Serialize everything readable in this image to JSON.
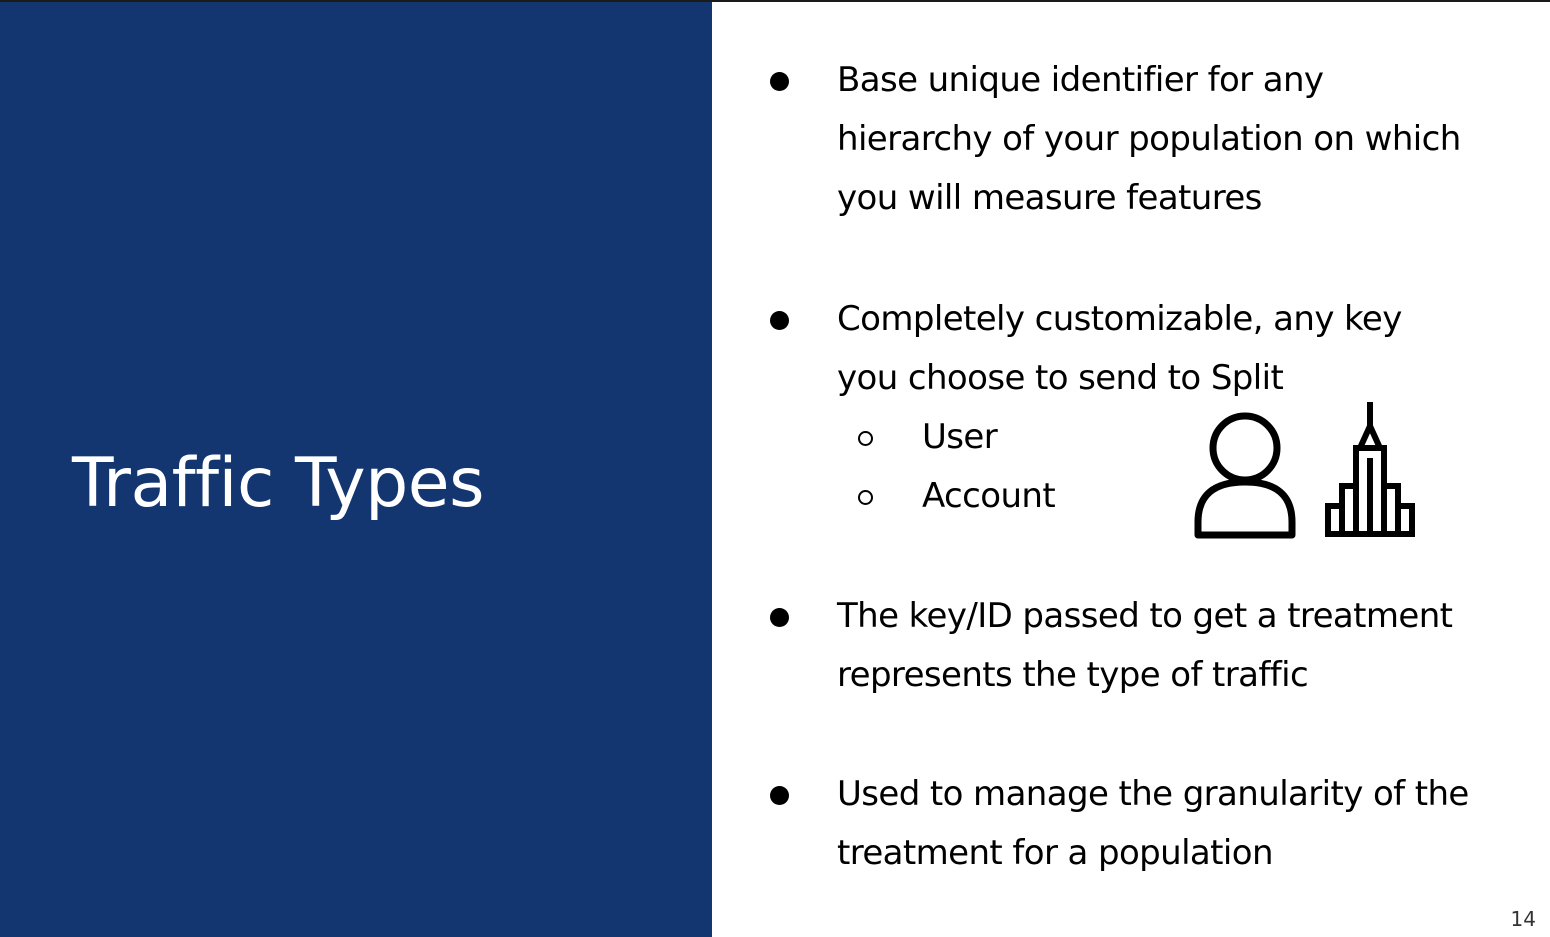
{
  "slide": {
    "title": "Traffic Types",
    "page_number": "14",
    "bullets": [
      {
        "lines": [
          "Base unique identifier for any",
          "hierarchy of your population on which",
          "you will measure features"
        ]
      },
      {
        "lines": [
          "Completely customizable,  any key",
          "you choose to send to Split"
        ],
        "sub_items": [
          "User",
          "Account"
        ]
      },
      {
        "lines": [
          "The key/ID passed to get a treatment",
          "represents the type of traffic"
        ]
      },
      {
        "lines": [
          "Used to manage the granularity of the",
          "treatment for a population"
        ]
      }
    ],
    "icons": [
      "user-icon",
      "building-icon"
    ],
    "colors": {
      "left_panel": "#133671",
      "title_text": "#ffffff",
      "body_text": "#000000"
    }
  }
}
